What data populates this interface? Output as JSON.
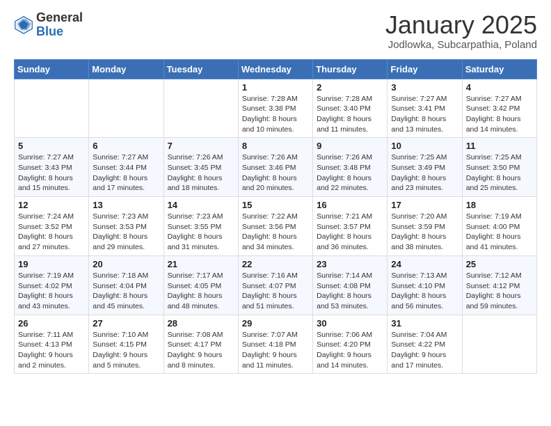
{
  "header": {
    "logo_general": "General",
    "logo_blue": "Blue",
    "month_title": "January 2025",
    "subtitle": "Jodlowka, Subcarpathia, Poland"
  },
  "weekdays": [
    "Sunday",
    "Monday",
    "Tuesday",
    "Wednesday",
    "Thursday",
    "Friday",
    "Saturday"
  ],
  "weeks": [
    [
      {
        "day": "",
        "info": ""
      },
      {
        "day": "",
        "info": ""
      },
      {
        "day": "",
        "info": ""
      },
      {
        "day": "1",
        "info": "Sunrise: 7:28 AM\nSunset: 3:38 PM\nDaylight: 8 hours\nand 10 minutes."
      },
      {
        "day": "2",
        "info": "Sunrise: 7:28 AM\nSunset: 3:40 PM\nDaylight: 8 hours\nand 11 minutes."
      },
      {
        "day": "3",
        "info": "Sunrise: 7:27 AM\nSunset: 3:41 PM\nDaylight: 8 hours\nand 13 minutes."
      },
      {
        "day": "4",
        "info": "Sunrise: 7:27 AM\nSunset: 3:42 PM\nDaylight: 8 hours\nand 14 minutes."
      }
    ],
    [
      {
        "day": "5",
        "info": "Sunrise: 7:27 AM\nSunset: 3:43 PM\nDaylight: 8 hours\nand 15 minutes."
      },
      {
        "day": "6",
        "info": "Sunrise: 7:27 AM\nSunset: 3:44 PM\nDaylight: 8 hours\nand 17 minutes."
      },
      {
        "day": "7",
        "info": "Sunrise: 7:26 AM\nSunset: 3:45 PM\nDaylight: 8 hours\nand 18 minutes."
      },
      {
        "day": "8",
        "info": "Sunrise: 7:26 AM\nSunset: 3:46 PM\nDaylight: 8 hours\nand 20 minutes."
      },
      {
        "day": "9",
        "info": "Sunrise: 7:26 AM\nSunset: 3:48 PM\nDaylight: 8 hours\nand 22 minutes."
      },
      {
        "day": "10",
        "info": "Sunrise: 7:25 AM\nSunset: 3:49 PM\nDaylight: 8 hours\nand 23 minutes."
      },
      {
        "day": "11",
        "info": "Sunrise: 7:25 AM\nSunset: 3:50 PM\nDaylight: 8 hours\nand 25 minutes."
      }
    ],
    [
      {
        "day": "12",
        "info": "Sunrise: 7:24 AM\nSunset: 3:52 PM\nDaylight: 8 hours\nand 27 minutes."
      },
      {
        "day": "13",
        "info": "Sunrise: 7:23 AM\nSunset: 3:53 PM\nDaylight: 8 hours\nand 29 minutes."
      },
      {
        "day": "14",
        "info": "Sunrise: 7:23 AM\nSunset: 3:55 PM\nDaylight: 8 hours\nand 31 minutes."
      },
      {
        "day": "15",
        "info": "Sunrise: 7:22 AM\nSunset: 3:56 PM\nDaylight: 8 hours\nand 34 minutes."
      },
      {
        "day": "16",
        "info": "Sunrise: 7:21 AM\nSunset: 3:57 PM\nDaylight: 8 hours\nand 36 minutes."
      },
      {
        "day": "17",
        "info": "Sunrise: 7:20 AM\nSunset: 3:59 PM\nDaylight: 8 hours\nand 38 minutes."
      },
      {
        "day": "18",
        "info": "Sunrise: 7:19 AM\nSunset: 4:00 PM\nDaylight: 8 hours\nand 41 minutes."
      }
    ],
    [
      {
        "day": "19",
        "info": "Sunrise: 7:19 AM\nSunset: 4:02 PM\nDaylight: 8 hours\nand 43 minutes."
      },
      {
        "day": "20",
        "info": "Sunrise: 7:18 AM\nSunset: 4:04 PM\nDaylight: 8 hours\nand 45 minutes."
      },
      {
        "day": "21",
        "info": "Sunrise: 7:17 AM\nSunset: 4:05 PM\nDaylight: 8 hours\nand 48 minutes."
      },
      {
        "day": "22",
        "info": "Sunrise: 7:16 AM\nSunset: 4:07 PM\nDaylight: 8 hours\nand 51 minutes."
      },
      {
        "day": "23",
        "info": "Sunrise: 7:14 AM\nSunset: 4:08 PM\nDaylight: 8 hours\nand 53 minutes."
      },
      {
        "day": "24",
        "info": "Sunrise: 7:13 AM\nSunset: 4:10 PM\nDaylight: 8 hours\nand 56 minutes."
      },
      {
        "day": "25",
        "info": "Sunrise: 7:12 AM\nSunset: 4:12 PM\nDaylight: 8 hours\nand 59 minutes."
      }
    ],
    [
      {
        "day": "26",
        "info": "Sunrise: 7:11 AM\nSunset: 4:13 PM\nDaylight: 9 hours\nand 2 minutes."
      },
      {
        "day": "27",
        "info": "Sunrise: 7:10 AM\nSunset: 4:15 PM\nDaylight: 9 hours\nand 5 minutes."
      },
      {
        "day": "28",
        "info": "Sunrise: 7:08 AM\nSunset: 4:17 PM\nDaylight: 9 hours\nand 8 minutes."
      },
      {
        "day": "29",
        "info": "Sunrise: 7:07 AM\nSunset: 4:18 PM\nDaylight: 9 hours\nand 11 minutes."
      },
      {
        "day": "30",
        "info": "Sunrise: 7:06 AM\nSunset: 4:20 PM\nDaylight: 9 hours\nand 14 minutes."
      },
      {
        "day": "31",
        "info": "Sunrise: 7:04 AM\nSunset: 4:22 PM\nDaylight: 9 hours\nand 17 minutes."
      },
      {
        "day": "",
        "info": ""
      }
    ]
  ]
}
